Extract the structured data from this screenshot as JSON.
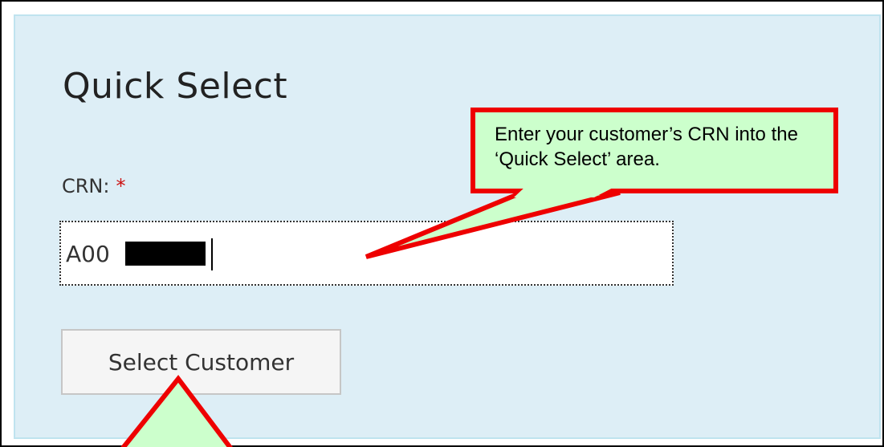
{
  "panel": {
    "title": "Quick Select",
    "crn_label": "CRN:",
    "required_marker": "*",
    "crn_value": "A00",
    "select_button_label": "Select Customer"
  },
  "callout": {
    "text": "Enter your customer’s CRN into the ‘Quick Select’ area."
  },
  "colors": {
    "panel_bg": "#ddeef6",
    "callout_bg": "#ccffcc",
    "callout_border": "#ee0000",
    "required": "#cc1111"
  }
}
